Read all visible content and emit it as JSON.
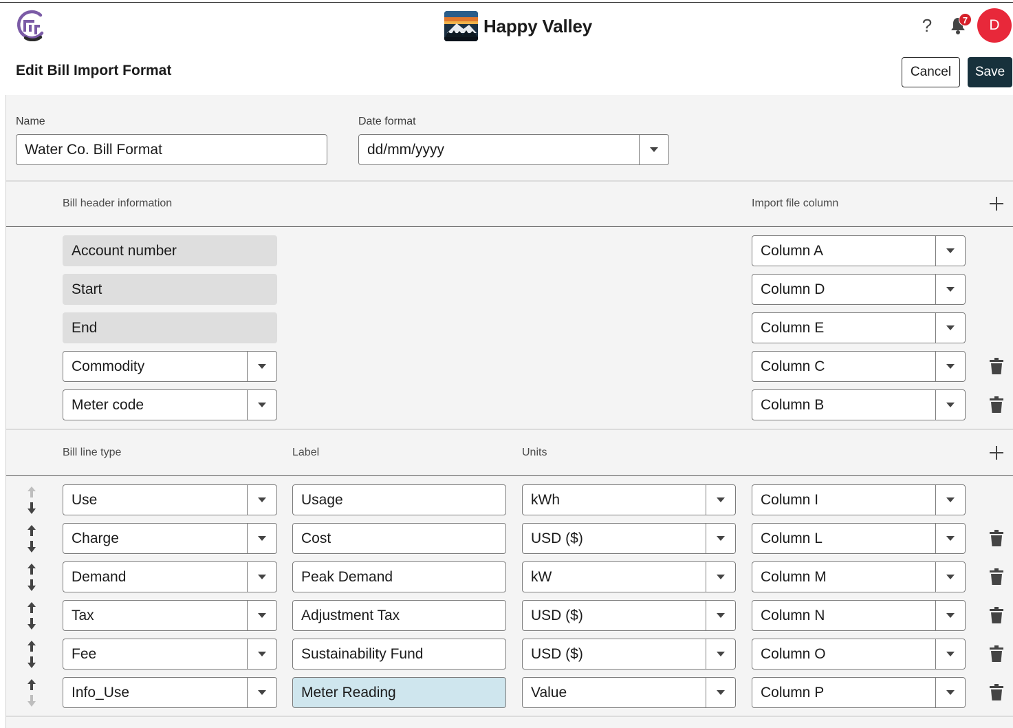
{
  "header": {
    "brand_name": "Happy Valley",
    "notification_count": "7",
    "help_label": "?",
    "avatar_initial": "D",
    "page_title": "Edit Bill Import Format",
    "cancel_label": "Cancel",
    "save_label": "Save"
  },
  "colors": {
    "primary": "#17313c",
    "avatar": "#e8283a",
    "badge": "#d6202a",
    "logo": "#7b5ba6",
    "highlight": "#cfe6ee"
  },
  "form": {
    "name_label": "Name",
    "name_value": "Water Co. Bill Format",
    "date_format_label": "Date format",
    "date_format_value": "dd/mm/yyyy"
  },
  "bill_header": {
    "col_info": "Bill header information",
    "col_import": "Import file column",
    "rows": [
      {
        "field": "Account number",
        "editable": false,
        "column": "Column A",
        "deletable": false
      },
      {
        "field": "Start",
        "editable": false,
        "column": "Column D",
        "deletable": false
      },
      {
        "field": "End",
        "editable": false,
        "column": "Column E",
        "deletable": false
      },
      {
        "field": "Commodity",
        "editable": true,
        "column": "Column C",
        "deletable": true
      },
      {
        "field": "Meter code",
        "editable": true,
        "column": "Column B",
        "deletable": true
      }
    ]
  },
  "bill_lines": {
    "col_type": "Bill line type",
    "col_label": "Label",
    "col_units": "Units",
    "rows": [
      {
        "type": "Use",
        "label": "Usage",
        "units": "kWh",
        "column": "Column I",
        "deletable": false
      },
      {
        "type": "Charge",
        "label": "Cost",
        "units": "USD ($)",
        "column": "Column L",
        "deletable": true
      },
      {
        "type": "Demand",
        "label": "Peak Demand",
        "units": "kW",
        "column": "Column M",
        "deletable": true
      },
      {
        "type": "Tax",
        "label": "Adjustment Tax",
        "units": "USD ($)",
        "column": "Column N",
        "deletable": true
      },
      {
        "type": "Fee",
        "label": "Sustainability Fund",
        "units": "USD ($)",
        "column": "Column O",
        "deletable": true
      },
      {
        "type": "Info_Use",
        "label": "Meter Reading",
        "units": "Value",
        "column": "Column P",
        "deletable": true
      }
    ]
  },
  "icons": [
    "app-logo-icon",
    "brand-logo-icon",
    "help-icon",
    "bell-icon",
    "caret-down-icon",
    "plus-icon",
    "trash-icon",
    "arrow-up-icon",
    "arrow-down-icon"
  ]
}
